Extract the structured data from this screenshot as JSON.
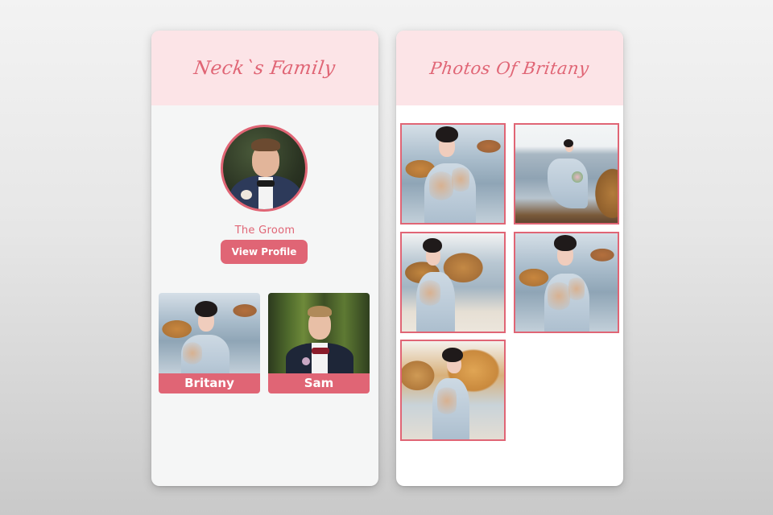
{
  "family_panel": {
    "title": "Neck`s Family",
    "groom": {
      "caption": "The Groom",
      "button_label": "View Profile",
      "photo": "groom-portrait"
    },
    "members": [
      {
        "name": "Britany",
        "photo": "bride-portrait"
      },
      {
        "name": "Sam",
        "photo": "groomsman-portrait"
      }
    ]
  },
  "photos_panel": {
    "title": "Photos Of Britany",
    "photos": [
      {
        "subject": "bride-closeup-sea"
      },
      {
        "subject": "bride-on-rocks-by-sea"
      },
      {
        "subject": "bride-rocky-beach"
      },
      {
        "subject": "bride-portrait-sea"
      },
      {
        "subject": "bride-golden-rocks"
      }
    ]
  },
  "colors": {
    "accent": "#e06575",
    "header_bg": "#fce4e7",
    "panel_left_bg": "#f5f6f6",
    "panel_right_bg": "#ffffff"
  }
}
